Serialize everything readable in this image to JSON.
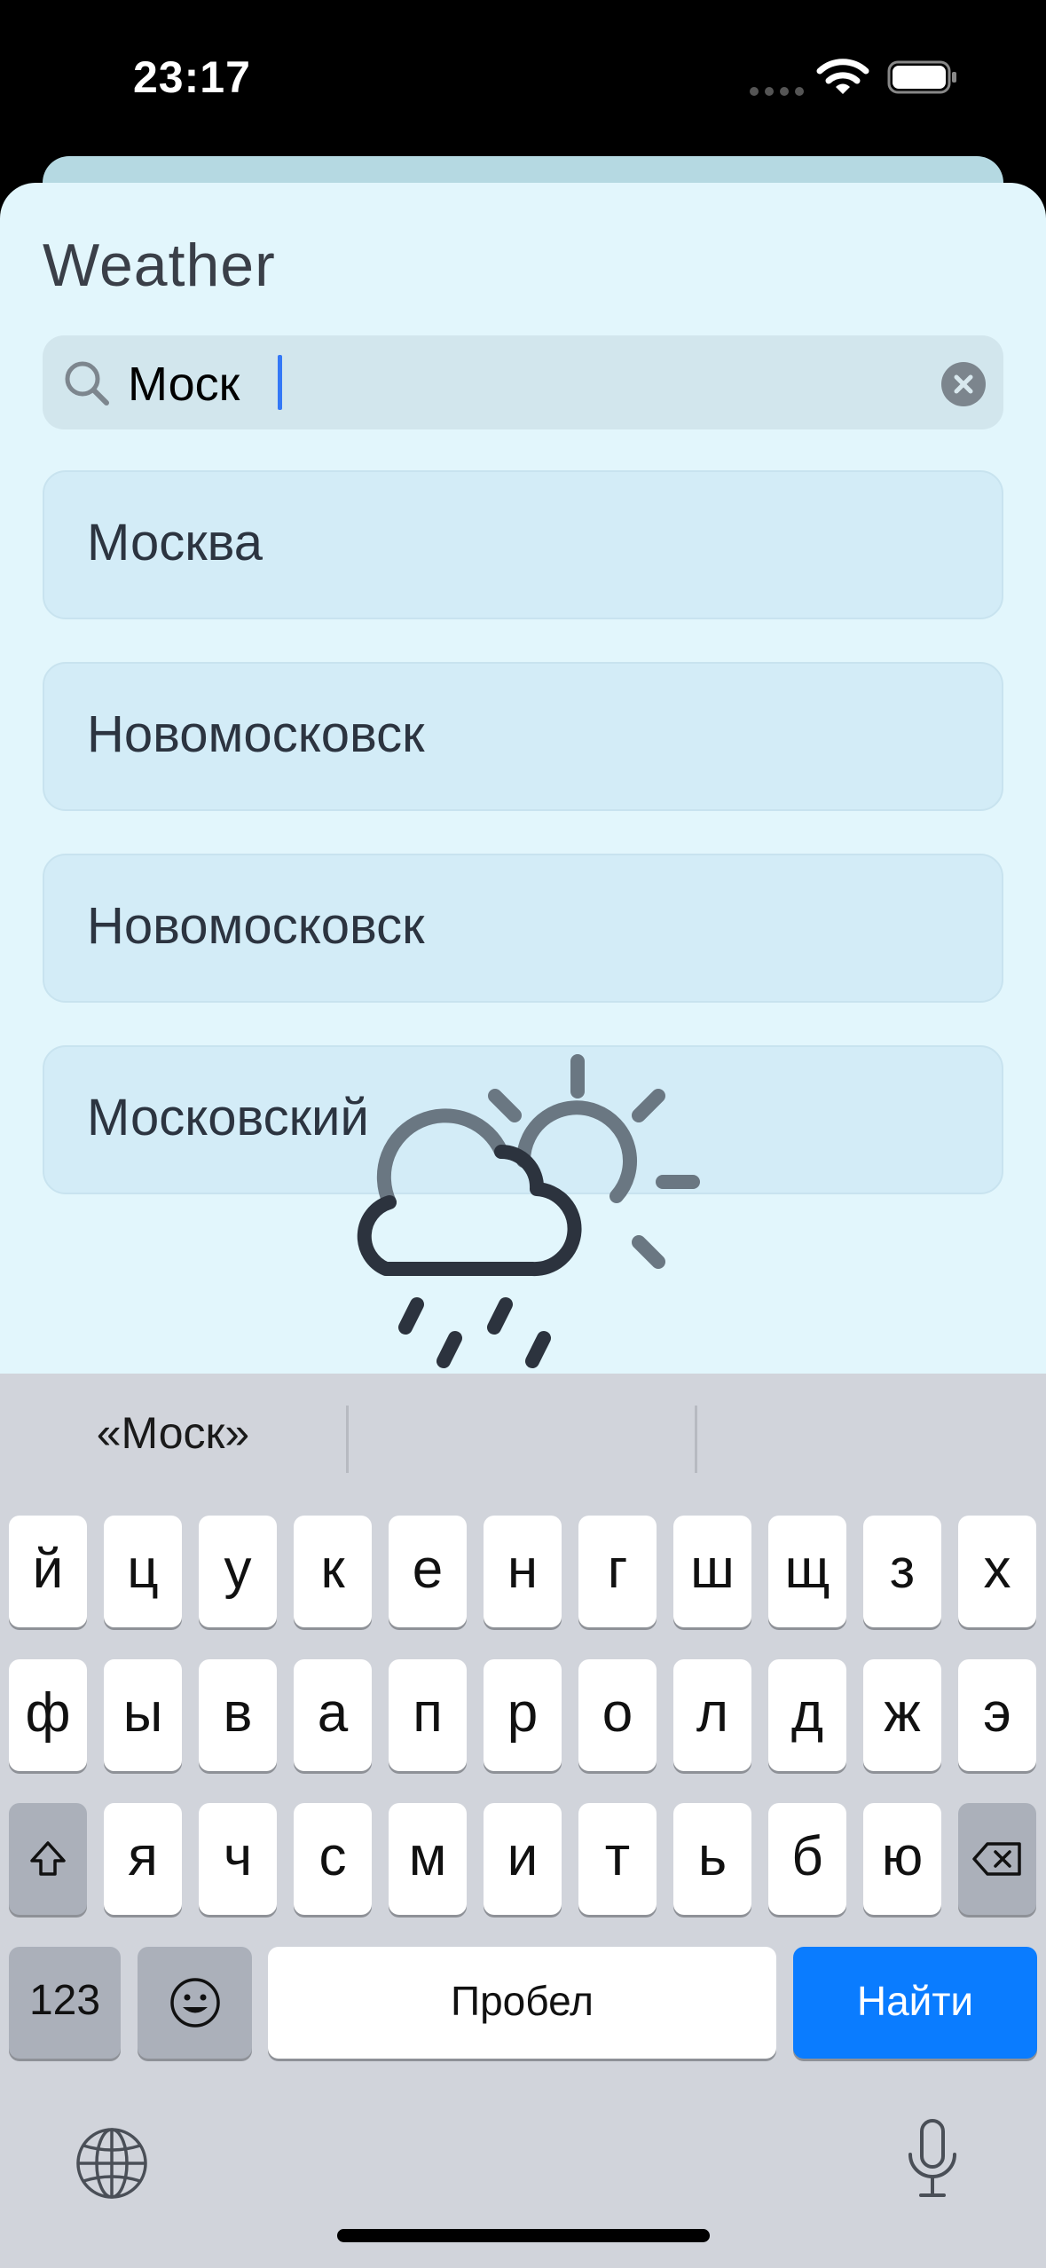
{
  "status_bar": {
    "time": "23:17"
  },
  "app": {
    "title": "Weather"
  },
  "search": {
    "value": "Моск"
  },
  "results": [
    {
      "label": "Москва"
    },
    {
      "label": "Новомосковск"
    },
    {
      "label": "Новомосковск"
    },
    {
      "label": "Московский"
    }
  ],
  "keyboard": {
    "suggestions": [
      "«Моск»",
      "",
      ""
    ],
    "row1": [
      "й",
      "ц",
      "у",
      "к",
      "е",
      "н",
      "г",
      "ш",
      "щ",
      "з",
      "х"
    ],
    "row2": [
      "ф",
      "ы",
      "в",
      "а",
      "п",
      "р",
      "о",
      "л",
      "д",
      "ж",
      "э"
    ],
    "row3": [
      "я",
      "ч",
      "с",
      "м",
      "и",
      "т",
      "ь",
      "б",
      "ю"
    ],
    "numbers_label": "123",
    "space_label": "Пробел",
    "return_label": "Найти"
  },
  "colors": {
    "accent": "#0A7CFF",
    "sheet_bg": "#E2F6FC",
    "result_bg": "#D3ECF7"
  },
  "icons": [
    "wifi-icon",
    "battery-icon",
    "search-icon",
    "clear-icon",
    "weather-rain-sun-icon",
    "shift-icon",
    "backspace-icon",
    "emoji-icon",
    "globe-icon",
    "microphone-icon"
  ]
}
